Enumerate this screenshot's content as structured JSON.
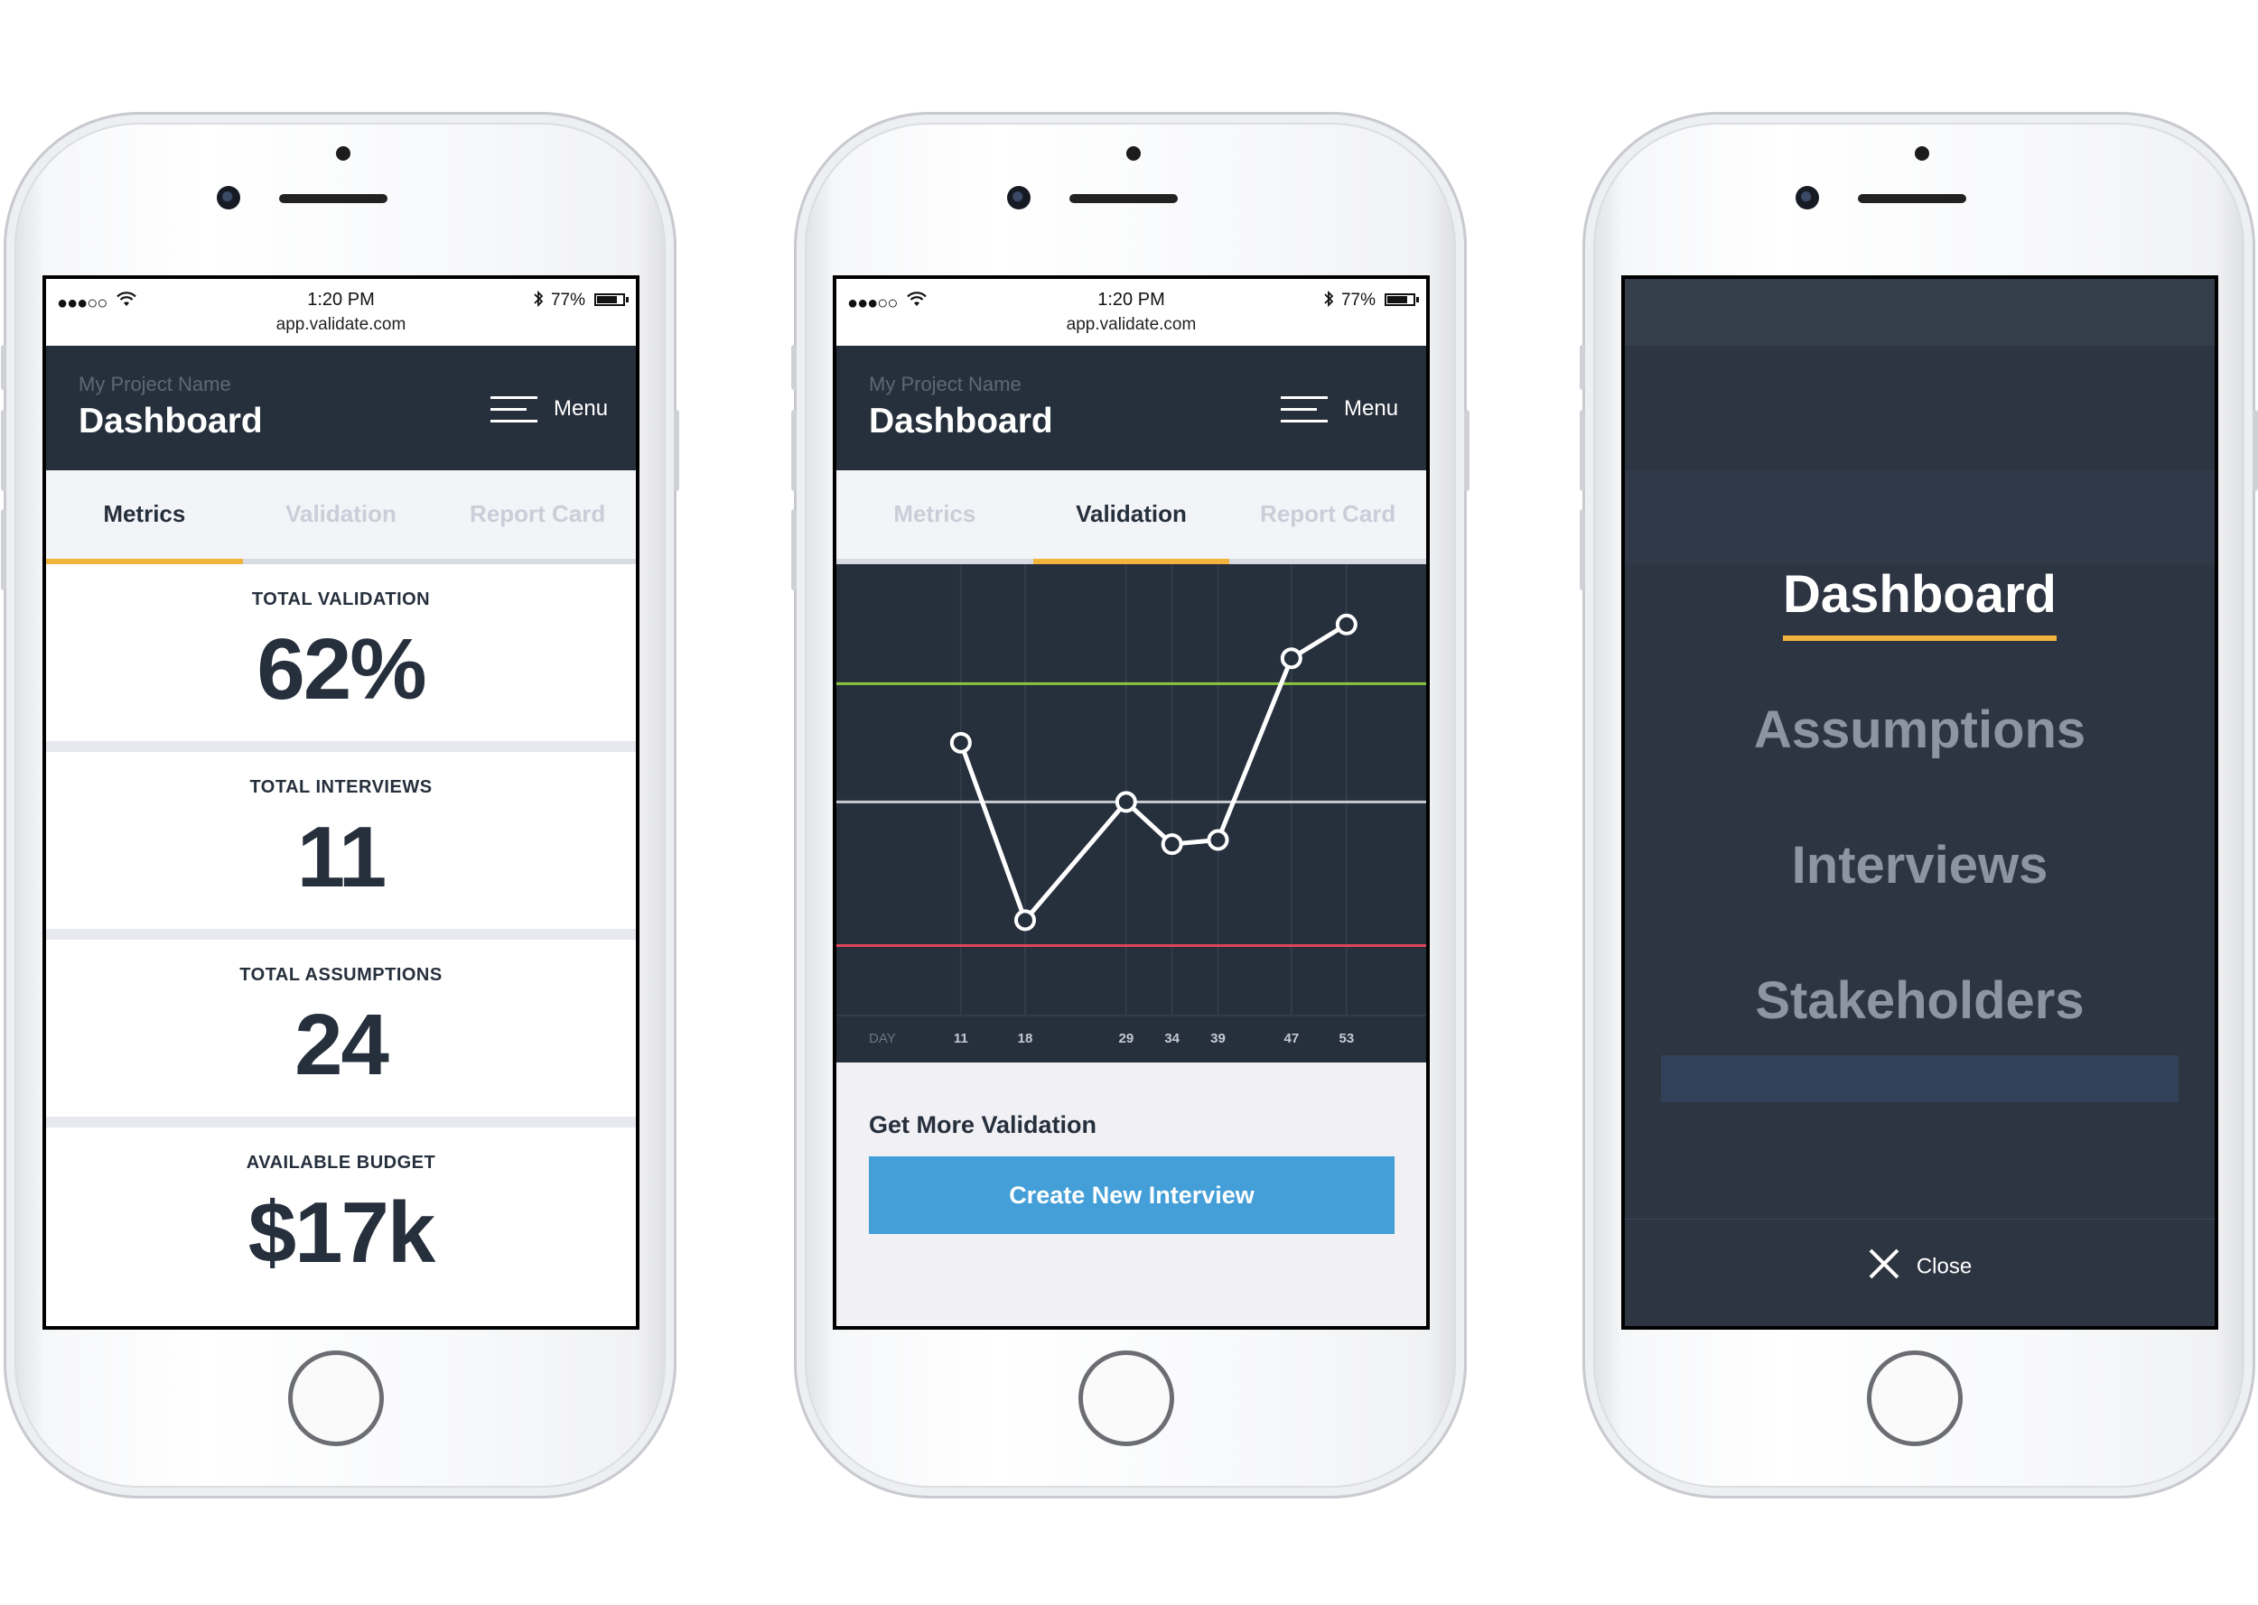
{
  "status_bar": {
    "signal": "●●●○○",
    "time": "1:20 PM",
    "url": "app.validate.com",
    "battery_pct": "77%",
    "battery_level": 0.77
  },
  "header": {
    "project_name": "My Project Name",
    "title": "Dashboard",
    "menu_label": "Menu"
  },
  "tabs": [
    {
      "label": "Metrics"
    },
    {
      "label": "Validation"
    },
    {
      "label": "Report Card"
    }
  ],
  "metrics": [
    {
      "label": "TOTAL VALIDATION",
      "value": "62%"
    },
    {
      "label": "TOTAL INTERVIEWS",
      "value": "11"
    },
    {
      "label": "TOTAL ASSUMPTIONS",
      "value": "24"
    },
    {
      "label": "AVAILABLE BUDGET",
      "value": "$17k"
    }
  ],
  "chart_data": {
    "type": "line",
    "xlabel": "DAY",
    "x": [
      11,
      18,
      29,
      34,
      39,
      47,
      53
    ],
    "x_tick_labels": [
      "11",
      "18",
      "29",
      "34",
      "39",
      "47",
      "53"
    ],
    "series": [
      {
        "values": [
          62,
          20,
          48,
          38,
          39,
          82,
          90
        ]
      }
    ],
    "reference_lines": [
      {
        "value": 76,
        "color": "#8cc63f"
      },
      {
        "value": 48,
        "color": "#c9ccd3"
      },
      {
        "value": 14,
        "color": "#e0455a"
      }
    ],
    "ylim": [
      0,
      100
    ],
    "grid": true,
    "colors": {
      "background": "#262f3c",
      "line": "#ffffff",
      "grid": "#323c4a"
    }
  },
  "validation": {
    "section_title": "Get More Validation",
    "cta_label": "Create New Interview"
  },
  "nav_menu": {
    "items": [
      {
        "label": "Dashboard",
        "active": true
      },
      {
        "label": "Assumptions",
        "active": false
      },
      {
        "label": "Interviews",
        "active": false
      },
      {
        "label": "Stakeholders",
        "active": false
      }
    ],
    "close_label": "Close"
  },
  "colors": {
    "header_bg": "#262f3c",
    "accent": "#f2b33d",
    "cta": "#449fd8"
  }
}
